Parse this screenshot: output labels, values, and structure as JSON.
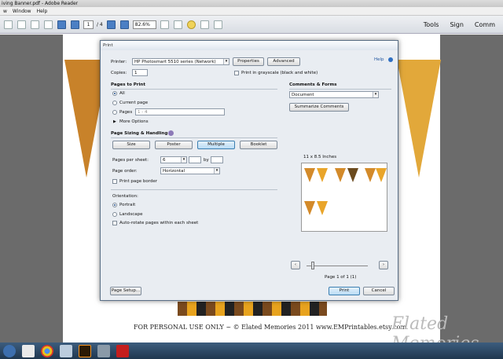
{
  "window": {
    "title": "iving Banner.pdf - Adobe Reader",
    "menu": [
      "w",
      "Window",
      "Help"
    ]
  },
  "toolbar": {
    "page_current": "1",
    "page_total": "/ 4",
    "zoom": "82.6%",
    "tools_label": "Tools",
    "sign_label": "Sign",
    "comment_label": "Comm"
  },
  "document": {
    "footer_text": "FOR PERSONAL USE ONLY ~ © Elated Memories 2011 www.EMPrintables.etsy.com",
    "signature": "Elated Memories"
  },
  "dialog": {
    "title": "Print",
    "help_label": "Help",
    "printer_label": "Printer:",
    "printer_value": "HP Photosmart 5510 series (Network)",
    "properties_label": "Properties",
    "advanced_label": "Advanced",
    "copies_label": "Copies:",
    "copies_value": "1",
    "grayscale_label": "Print in grayscale (black and white)",
    "pages_to_print_title": "Pages to Print",
    "opt_all": "All",
    "opt_current": "Current page",
    "opt_pages": "Pages",
    "pages_range": "1 - 4",
    "more_options": "More Options",
    "sizing_title": "Page Sizing & Handling",
    "size_btn": "Size",
    "poster_btn": "Poster",
    "multiple_btn": "Multiple",
    "booklet_btn": "Booklet",
    "pages_per_sheet_label": "Pages per sheet:",
    "pages_per_sheet_value": "6",
    "by_label": "by",
    "page_order_label": "Page order:",
    "page_order_value": "Horizontal",
    "page_border_label": "Print page border",
    "orientation_title": "Orientation:",
    "portrait_label": "Portrait",
    "landscape_label": "Landscape",
    "autorotate_label": "Auto-rotate pages within each sheet",
    "comments_title": "Comments & Forms",
    "comments_value": "Document",
    "summarize_label": "Summarize Comments",
    "paper_size": "11 x 8.5 Inches",
    "page_indicator": "Page 1 of 1 (1)",
    "page_setup_label": "Page Setup...",
    "print_label": "Print",
    "cancel_label": "Cancel"
  },
  "colors": {
    "accent": "#3c7fb1",
    "banner_orange": "#c8822a"
  }
}
